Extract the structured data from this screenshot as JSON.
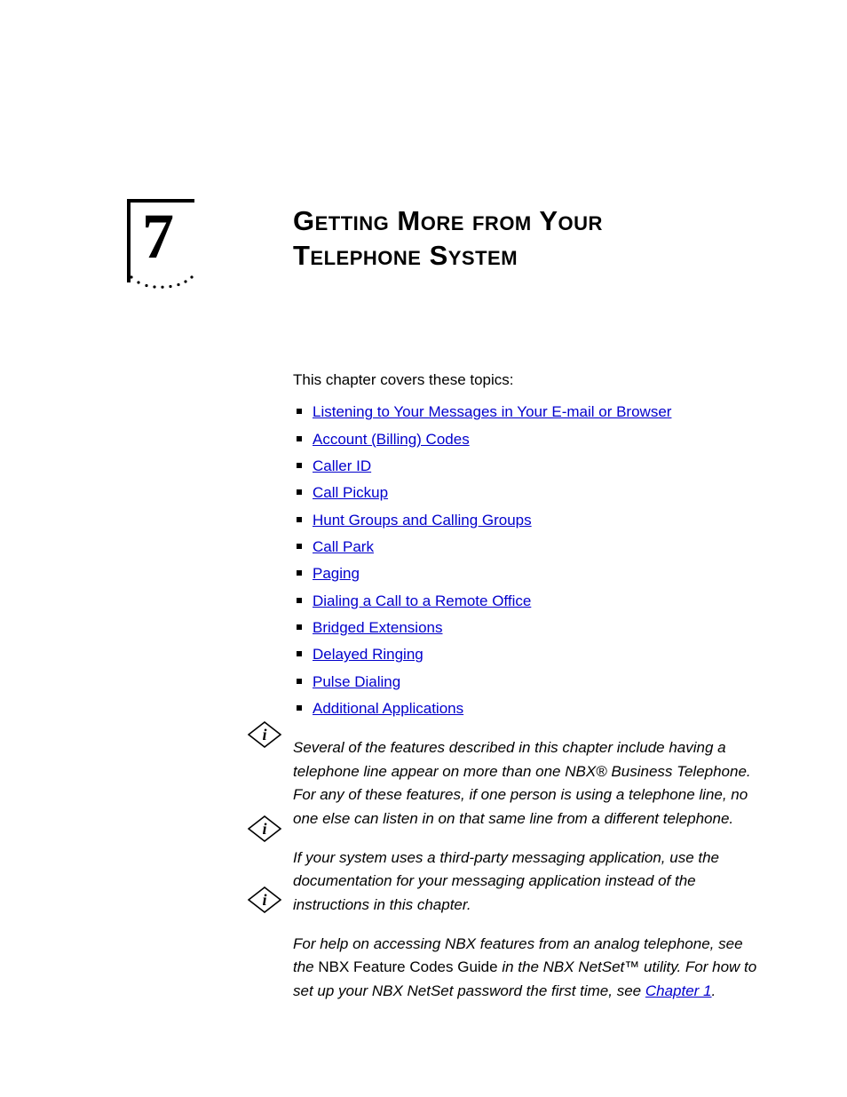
{
  "chapter_number": "7",
  "heading": "Getting More from Your Telephone System",
  "intro": "This chapter covers these topics:",
  "topics": [
    "Listening to Your Messages in Your E-mail or Browser",
    "Account (Billing) Codes",
    "Caller ID",
    "Call Pickup",
    "Hunt Groups and Calling Groups",
    "Call Park",
    "Paging",
    "Dialing a Call to a Remote Office",
    "Bridged Extensions",
    "Delayed Ringing",
    "Pulse Dialing",
    "Additional Applications"
  ],
  "notes": {
    "n1": "Several of the features described in this chapter include having a telephone line appear on more than one NBX® Business Telephone. For any of these features, if one person is using a telephone line, no one else can listen in on that same line from a different telephone.",
    "n2": "If your system uses a third-party messaging application, use the documentation for your messaging application instead of the instructions in this chapter.",
    "n3_lead_italic": "For help on accessing NBX features from an analog telephone, see the",
    "n3_roman": "NBX Feature Codes Guide",
    "n3_mid_italic": " in the NBX NetSet™ utility. For how to set up your NBX NetSet password the first time, see ",
    "n3_link": "Chapter 1",
    "n3_end": "."
  }
}
